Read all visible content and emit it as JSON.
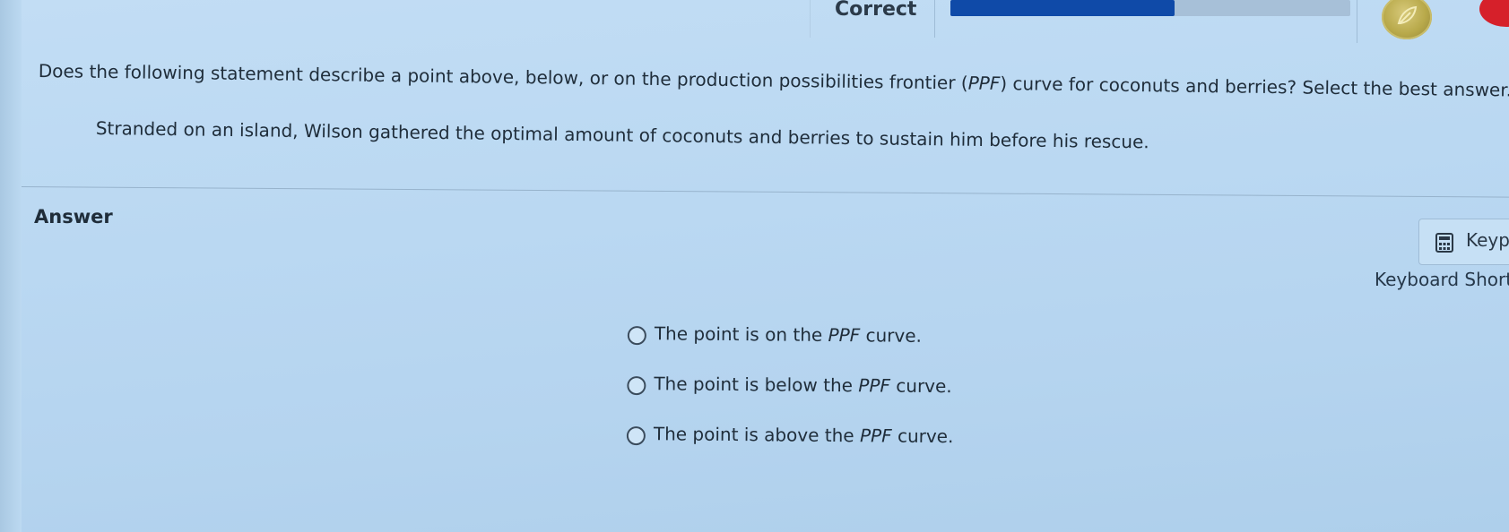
{
  "header": {
    "status_text": "Correct",
    "progress_fraction": 0.56,
    "colors": {
      "progress_fill": "#0f4aa8",
      "progress_track": "#a7c0d8",
      "badge": "#b8a94a",
      "alert": "#d6202a"
    },
    "badge_icon": "leaf-icon"
  },
  "question": {
    "prompt_before": "Does the following statement describe a point above, below, or on the production possibilities frontier (",
    "prompt_abbrev": "PPF",
    "prompt_after": ") curve for coconuts and berries? Select the best answer.",
    "statement": "Stranded on an island, Wilson gathered the optimal amount of coconuts and berries to sustain him before his rescue."
  },
  "answer": {
    "heading": "Answer",
    "keypad_label": "Keyp",
    "keypad_icon": "calculator-icon",
    "shortcuts_label": "Keyboard Short",
    "options": [
      {
        "before": "The point is on the ",
        "abbrev": "PPF",
        "after": " curve."
      },
      {
        "before": "The point is below the ",
        "abbrev": "PPF",
        "after": " curve."
      },
      {
        "before": "The point is above the ",
        "abbrev": "PPF",
        "after": " curve."
      }
    ]
  }
}
